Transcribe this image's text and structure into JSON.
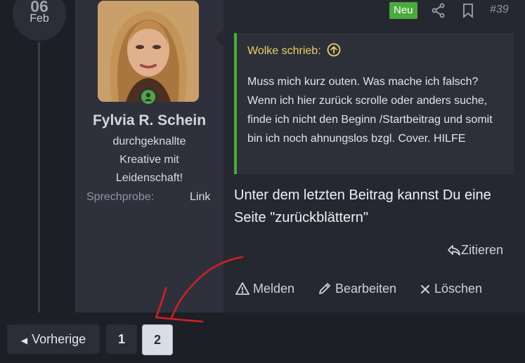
{
  "date": {
    "day": "06",
    "month": "Feb"
  },
  "user": {
    "name": "Fylvia R. Schein",
    "title": "durchgeknallte Kreative mit Leidenschaft!",
    "field_label": "Sprechprobe:",
    "field_value": "Link"
  },
  "post": {
    "badge": "Neu",
    "number": "#39",
    "quote_author": "Wolke schrieb:",
    "quote_text": "Muss mich kurz outen. Was mache ich falsch? Wenn ich hier zurück scrolle oder anders suche, finde ich nicht den Beginn /Startbeitrag und somit bin ich noch ahnungslos bzgl. Cover. HILFE",
    "message": "Unter dem letzten Beitrag kannst Du eine Seite \"zurückblättern\"",
    "actions": {
      "quote": "Zitieren",
      "report": "Melden",
      "edit": "Bearbeiten",
      "delete": "Löschen"
    }
  },
  "pagination": {
    "prev": "Vorherige",
    "pages": [
      "1",
      "2"
    ],
    "current": "2"
  },
  "colors": {
    "accent_green": "#4caa3c",
    "quote_author": "#e8d068",
    "annotation_red": "#d62020"
  }
}
